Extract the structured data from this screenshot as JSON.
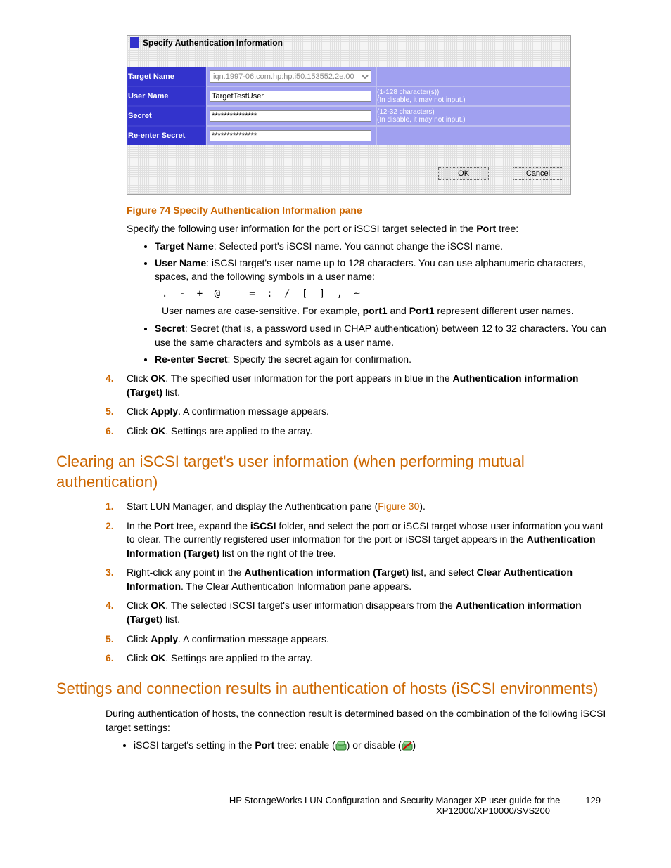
{
  "screenshot": {
    "pane_title": "Specify Authentication Information",
    "rows": {
      "target_name": {
        "label": "Target Name",
        "value": "iqn.1997-06.com.hp:hp.i50.153552.2e.00",
        "hint": ""
      },
      "user_name": {
        "label": "User Name",
        "value": "TargetTestUser",
        "hint": "(1-128 character(s))\n(In disable, it may not input.)"
      },
      "secret": {
        "label": "Secret",
        "value": "***************",
        "hint": "(12-32 characters)\n(In disable, it may not input.)"
      },
      "reenter": {
        "label": "Re-enter Secret",
        "value": "***************",
        "hint": ""
      }
    },
    "buttons": {
      "ok": "OK",
      "cancel": "Cancel"
    }
  },
  "caption": "Figure 74 Specify Authentication Information pane",
  "intro": {
    "pre": "Specify the following user information for the port or iSCSI target selected in the ",
    "bold": "Port",
    "post": " tree:"
  },
  "bullets_a": [
    {
      "b": "Target Name",
      "t": ":  Selected port's iSCSI name.  You cannot change the iSCSI name."
    },
    {
      "b": "User Name",
      "t": ":  iSCSI target's user name up to 128 characters.  You can use alphanumeric characters, spaces, and the following symbols in a user name:"
    }
  ],
  "symbols": ". - + @ _ = : / [ ] , ~",
  "case_note": {
    "pre": "User names are case-sensitive.  For example, ",
    "b1": "port1",
    "mid": " and ",
    "b2": "Port1",
    "post": " represent different user names."
  },
  "bullets_b": [
    {
      "b": "Secret",
      "t": ":  Secret (that is, a password used in CHAP authentication) between 12 to 32 characters.  You can use the same characters and symbols as a user name."
    },
    {
      "b": "Re-enter Secret",
      "t": ":  Specify the secret again for confirmation."
    }
  ],
  "steps_a": [
    {
      "n": "4.",
      "pre": "Click ",
      "b1": "OK",
      "mid": ". The specified user information for the port appears in blue in the ",
      "b2": "Authentication information (Target)",
      "post": " list."
    },
    {
      "n": "5.",
      "pre": "Click ",
      "b1": "Apply",
      "mid": ".  A confirmation message appears.",
      "b2": "",
      "post": ""
    },
    {
      "n": "6.",
      "pre": "Click ",
      "b1": "OK",
      "mid": ". Settings are applied to the array.",
      "b2": "",
      "post": ""
    }
  ],
  "h2_a": "Clearing an iSCSI target's user information (when performing mutual authentication)",
  "steps_b": [
    {
      "n": "1.",
      "html": "Start LUN Manager, and display the Authentication pane (<span class='link'>Figure 30</span>)."
    },
    {
      "n": "2.",
      "html": "In the <b>Port</b> tree, expand the <b>iSCSI</b> folder, and select the port or iSCSI target whose user information you want to clear.  The currently registered user information for the port or iSCSI target appears in the <b>Authentication Information (Target)</b> list on the right of the tree."
    },
    {
      "n": "3.",
      "html": "Right-click any point in the <b>Authentication information (Target)</b> list, and select <b>Clear Authentication Information</b>.  The Clear Authentication Information pane appears."
    },
    {
      "n": "4.",
      "html": "Click <b>OK</b>. The selected iSCSI target's user information disappears from the <b>Authentication information (Target</b>) list."
    },
    {
      "n": "5.",
      "html": "Click <b>Apply</b>.  A confirmation message appears."
    },
    {
      "n": "6.",
      "html": "Click <b>OK</b>. Settings are applied to the array."
    }
  ],
  "h2_b": "Settings and connection results in authentication of hosts (iSCSI environments)",
  "para_b": "During authentication of hosts, the connection result is determined based on the combination of the following iSCSI target settings:",
  "bullet_c": {
    "pre": "iSCSI target's setting in the ",
    "b": "Port",
    "mid": " tree:  enable (",
    "post1": ") or disable (",
    "post2": ")"
  },
  "footer": {
    "line1": "HP StorageWorks LUN Configuration and Security Manager XP user guide for the",
    "page": "129",
    "line2": "XP12000/XP10000/SVS200"
  }
}
